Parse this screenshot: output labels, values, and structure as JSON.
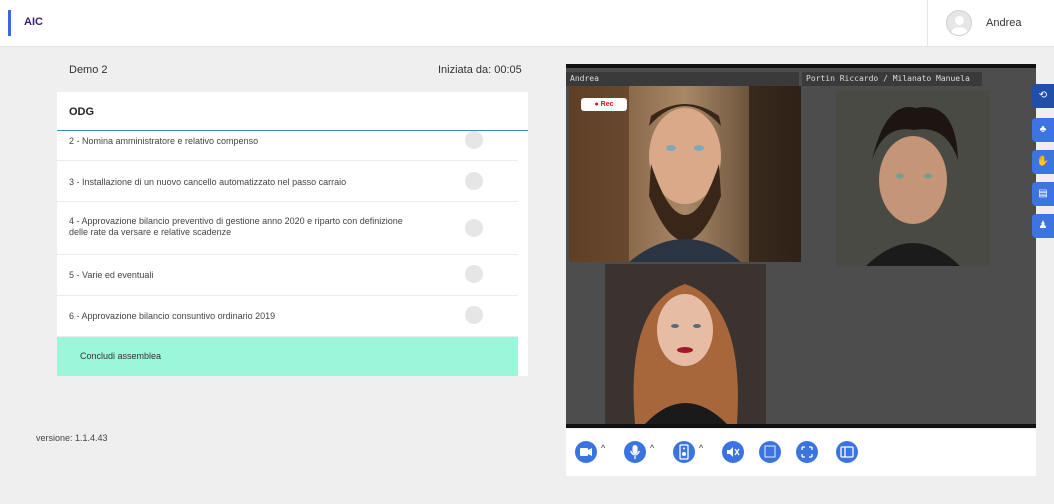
{
  "header": {
    "brand": "AIC",
    "user_name": "Andrea"
  },
  "meeting": {
    "title": "Demo 2",
    "started_label": "Iniziata da: 00:05"
  },
  "agenda": {
    "title": "ODG",
    "items": [
      {
        "label": "2 - Nomina amministratore e relativo compenso"
      },
      {
        "label": "3 - Installazione di un nuovo cancello automatizzato nel passo carraio"
      },
      {
        "label": "4 - Approvazione bilancio preventivo di gestione anno 2020 e riparto con definizione delle rate da versare e relative scadenze"
      },
      {
        "label": "5 - Varie ed eventuali"
      },
      {
        "label": "6 - Approvazione bilancio consuntivo ordinario 2019"
      }
    ],
    "conclude_label": "Concludi assemblea"
  },
  "version": "versione: 1.1.4.43",
  "video": {
    "main_label": "Andrea",
    "secondary_label": "Portin Riccardo / Milanato Manuela",
    "rec_label": "Rec"
  },
  "sidebar_icons": [
    "history-icon",
    "group-icon",
    "hand-raise-icon",
    "chat-icon",
    "participants-icon"
  ],
  "controls": [
    "camera-icon",
    "microphone-icon",
    "speaker-icon",
    "mute-audio-icon",
    "screen-share-icon",
    "fullscreen-icon",
    "layout-icon"
  ],
  "colors": {
    "accent": "#3b74e0",
    "conclude": "#9cf6da",
    "brand": "#3a1f7a"
  }
}
